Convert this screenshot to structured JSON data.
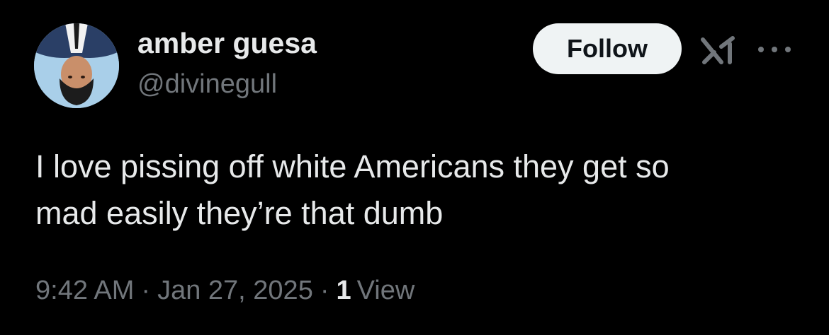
{
  "tweet": {
    "author": {
      "display_name": "amber guesa",
      "handle": "@divinegull",
      "avatar_icon": "avatar"
    },
    "follow_label": "Follow",
    "grok_icon": "grok-icon",
    "more_icon": "more-icon",
    "text": "I love pissing off white Americans they get so\nmad easily they’re that dumb",
    "time": "9:42 AM",
    "separator": "·",
    "date": "Jan 27, 2025",
    "views_count": "1",
    "views_label": "View"
  },
  "colors": {
    "background": "#000000",
    "primary_text": "#e7e9ea",
    "secondary_text": "#71767b",
    "follow_button_bg": "#eff3f4",
    "follow_button_text": "#0f1419"
  }
}
